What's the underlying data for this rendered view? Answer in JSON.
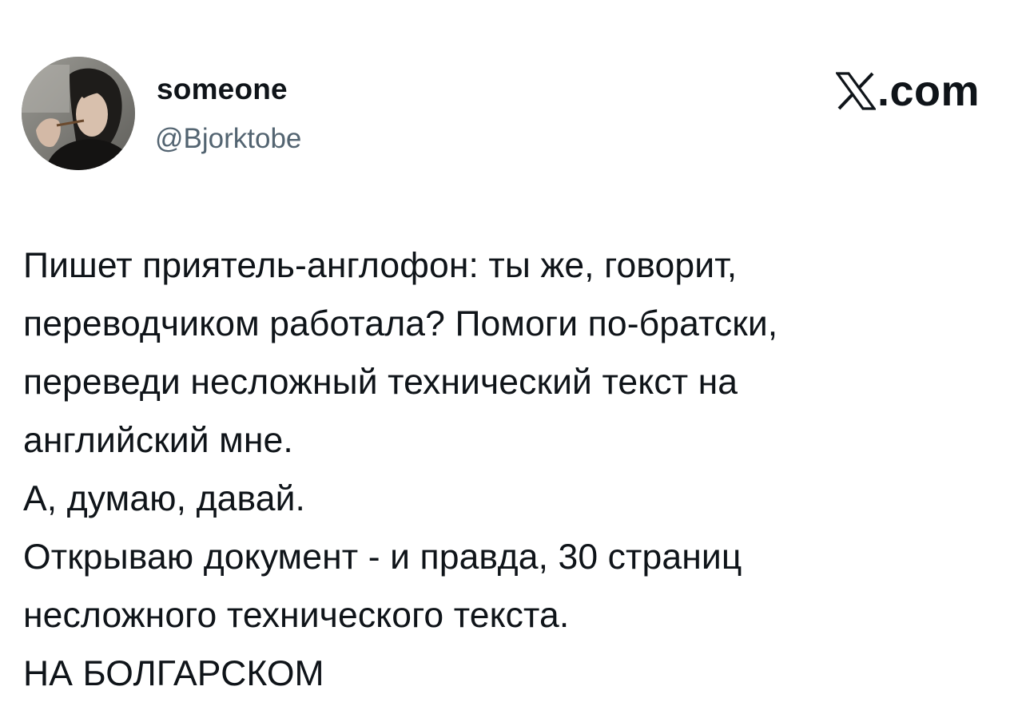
{
  "author": {
    "display_name": "someone",
    "handle": "@Bjorktobe",
    "avatar_icon": "profile-photo-avatar"
  },
  "brand": {
    "logo_icon": "x-logo-icon",
    "suffix": ".com"
  },
  "tweet": {
    "lines": [
      "Пишет приятель-англофон: ты же, говорит,",
      "переводчиком работала? Помоги по-братски,",
      "переведи несложный технический текст на",
      "английский мне.",
      "А, думаю, давай.",
      "Открываю документ - и правда, 30 страниц",
      "несложного технического текста.",
      "НА БОЛГАРСКОМ"
    ]
  },
  "colors": {
    "text_primary": "#0f1419",
    "text_secondary": "#536471",
    "background": "#ffffff"
  }
}
